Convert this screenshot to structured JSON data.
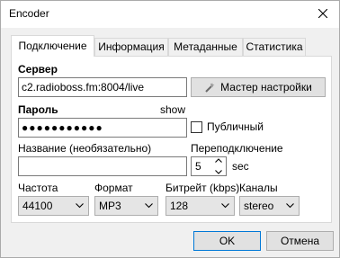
{
  "window": {
    "title": "Encoder"
  },
  "tabs": [
    {
      "label": "Подключение",
      "active": true
    },
    {
      "label": "Информация",
      "active": false
    },
    {
      "label": "Метаданные",
      "active": false
    },
    {
      "label": "Статистика",
      "active": false
    }
  ],
  "form": {
    "server_label": "Сервер",
    "server_value": "c2.radioboss.fm:8004/live",
    "wizard_button": "Мастер настройки",
    "password_label": "Пароль",
    "show_link": "show",
    "password_value": "●●●●●●●●●●●",
    "public_checkbox": {
      "label": "Публичный",
      "checked": false
    },
    "name_label": "Название (необязательно)",
    "name_value": "",
    "reconnect_label": "Переподключение",
    "reconnect_value": "5",
    "reconnect_unit": "sec",
    "frequency_label": "Частота",
    "frequency_value": "44100",
    "format_label": "Формат",
    "format_value": "MP3",
    "bitrate_label": "Битрейт (kbps)",
    "bitrate_value": "128",
    "channels_label": "Каналы",
    "channels_value": "stereo"
  },
  "buttons": {
    "ok": "OK",
    "cancel": "Отмена"
  },
  "icons": {
    "close": "close-icon",
    "wizard": "wand-icon",
    "dropdown": "chevron-down-icon",
    "spin": "spin-arrows-icon"
  },
  "colors": {
    "focus_border": "#0078d7",
    "window_bg": "#f0f0f0"
  }
}
